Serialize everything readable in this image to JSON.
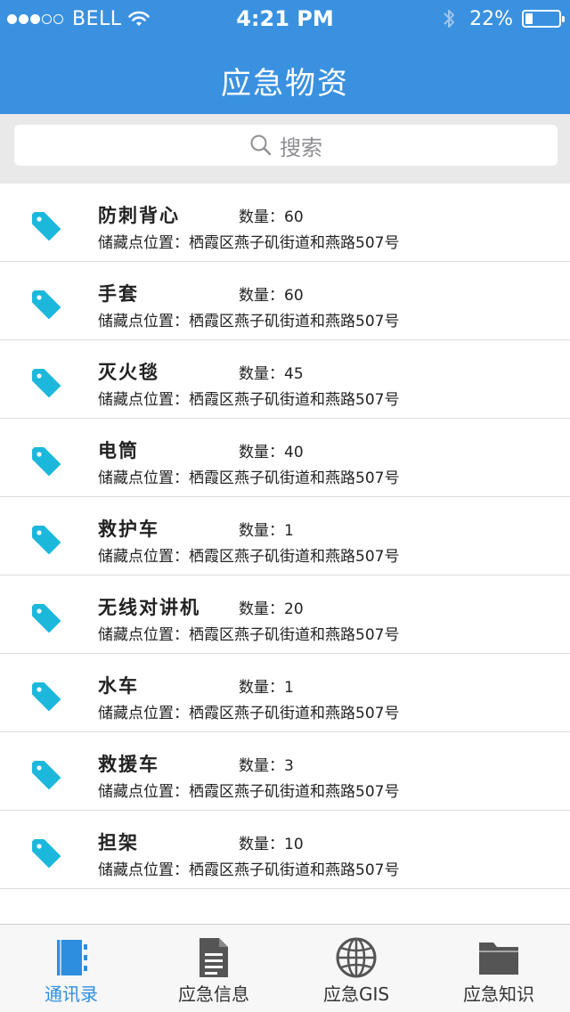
{
  "status_bar": {
    "carrier": "BELL",
    "time": "4:21 PM",
    "battery": "22%",
    "battery_level": 0.22
  },
  "header": {
    "title": "应急物资"
  },
  "search": {
    "placeholder": "搜索"
  },
  "items": [
    {
      "name": "防刺背心",
      "quantity": "数量：60",
      "location": "储藏点位置：栖霞区燕子矶街道和燕路507号"
    },
    {
      "name": "手套",
      "quantity": "数量：60",
      "location": "储藏点位置：栖霞区燕子矶街道和燕路507号"
    },
    {
      "name": "灭火毯",
      "quantity": "数量：45",
      "location": "储藏点位置：栖霞区燕子矶街道和燕路507号"
    },
    {
      "name": "电筒",
      "quantity": "数量：40",
      "location": "储藏点位置：栖霞区燕子矶街道和燕路507号"
    },
    {
      "name": "救护车",
      "quantity": "数量：1",
      "location": "储藏点位置：栖霞区燕子矶街道和燕路507号"
    },
    {
      "name": "无线对讲机",
      "quantity": "数量：20",
      "location": "储藏点位置：栖霞区燕子矶街道和燕路507号"
    },
    {
      "name": "水车",
      "quantity": "数量：1",
      "location": "储藏点位置：栖霞区燕子矶街道和燕路507号"
    },
    {
      "name": "救援车",
      "quantity": "数量：3",
      "location": "储藏点位置：栖霞区燕子矶街道和燕路507号"
    },
    {
      "name": "担架",
      "quantity": "数量：10",
      "location": "储藏点位置：栖霞区燕子矶街道和燕路507号"
    }
  ],
  "tabbar": {
    "tabs": [
      {
        "label": "通讯录",
        "icon": "address-book-icon",
        "active": true
      },
      {
        "label": "应急信息",
        "icon": "document-icon",
        "active": false
      },
      {
        "label": "应急GIS",
        "icon": "globe-icon",
        "active": false
      },
      {
        "label": "应急知识",
        "icon": "folder-icon",
        "active": false
      }
    ]
  },
  "colors": {
    "header_bg": "#3a91e0",
    "tag_icon": "#1cb8dc",
    "tab_active": "#2d8ee0",
    "tab_inactive": "#555555"
  }
}
